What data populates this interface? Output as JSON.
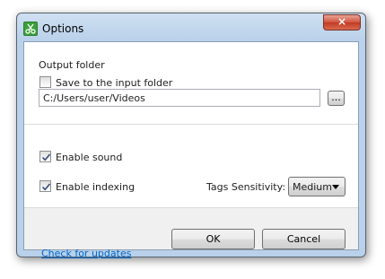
{
  "window": {
    "title": "Options",
    "icon": "scissors-icon",
    "close_label": "×"
  },
  "output": {
    "section_label": "Output folder",
    "save_to_input_label": "Save to the input folder",
    "save_to_input_checked": false,
    "folder_path": "C:/Users/user/Videos",
    "browse_label": "..."
  },
  "settings": {
    "enable_sound_label": "Enable sound",
    "enable_sound_checked": true,
    "enable_indexing_label": "Enable indexing",
    "enable_indexing_checked": true,
    "tags_sensitivity_label": "Tags Sensitivity:",
    "tags_sensitivity_value": "Medium"
  },
  "footer": {
    "check_updates_label": "Check for updates",
    "ok_label": "OK",
    "cancel_label": "Cancel"
  },
  "colors": {
    "link": "#0066cc",
    "titlebar": "#b9d1ea",
    "close_button": "#c23a23",
    "icon_green": "#3aa13a"
  }
}
